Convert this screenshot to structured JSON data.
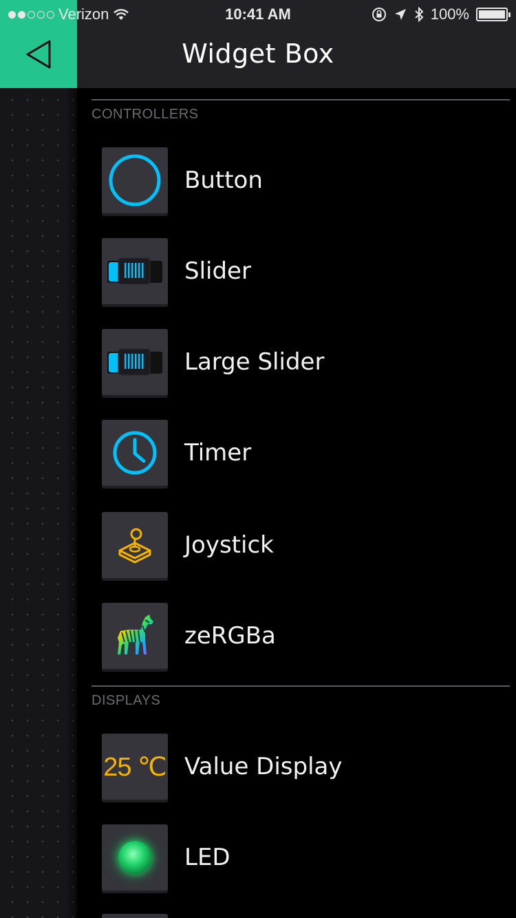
{
  "status_bar": {
    "carrier": "Verizon",
    "time": "10:41 AM",
    "battery": "100%",
    "signal_dots_filled": 2,
    "signal_dots_total": 5
  },
  "header": {
    "title": "Widget Box",
    "back_icon": "back-triangle-icon",
    "accent": "#23C48E"
  },
  "sections": {
    "controllers": "CONTROLLERS",
    "displays": "DISPLAYS"
  },
  "items": [
    {
      "label": "Button",
      "icon": "button-circle-icon"
    },
    {
      "label": "Slider",
      "icon": "slider-icon"
    },
    {
      "label": "Large Slider",
      "icon": "large-slider-icon"
    },
    {
      "label": "Timer",
      "icon": "clock-icon"
    },
    {
      "label": "Joystick",
      "icon": "joystick-icon"
    },
    {
      "label": "zeRGBa",
      "icon": "zebra-icon"
    },
    {
      "label": "Value Display",
      "icon": "value-display-icon",
      "icon_text": "25 ℃"
    },
    {
      "label": "LED",
      "icon": "led-icon"
    }
  ],
  "colors": {
    "cyan": "#04C0F8",
    "amber": "#F5B400",
    "led_green": "#21D36B",
    "tile": "#35353B"
  }
}
